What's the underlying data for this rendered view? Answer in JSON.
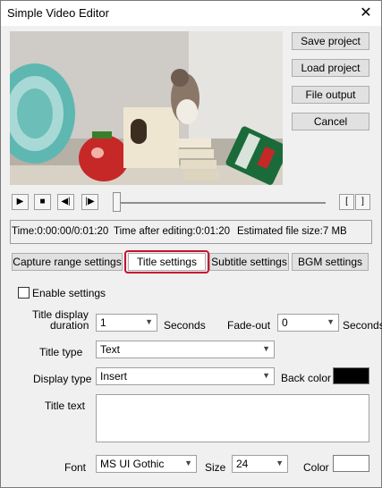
{
  "window": {
    "title": "Simple Video Editor"
  },
  "sidebar_buttons": {
    "save_project": "Save project",
    "load_project": "Load project",
    "file_output": "File output",
    "cancel": "Cancel"
  },
  "player": {
    "controls": [
      "▶",
      "■",
      "◀|",
      "|▶"
    ],
    "mark_in": "[",
    "mark_out": "]",
    "position_fraction": 0.0
  },
  "status": {
    "time": "Time:0:00:00/0:01:20",
    "after_edit": "Time after editing:0:01:20",
    "file_size": "Estimated file size:7 MB"
  },
  "tabs": [
    {
      "label": "Capture range settings",
      "active": false
    },
    {
      "label": "Title settings",
      "active": true
    },
    {
      "label": "Subtitle settings",
      "active": false
    },
    {
      "label": "BGM settings",
      "active": false
    }
  ],
  "title_settings": {
    "enable_label": "Enable settings",
    "enabled": false,
    "duration_label_line1": "Title display",
    "duration_label_line2": "duration",
    "duration_value": "1",
    "duration_unit": "Seconds",
    "fadeout_label": "Fade-out",
    "fadeout_value": "0",
    "fadeout_unit": "Seconds",
    "title_type_label": "Title type",
    "title_type_value": "Text",
    "display_type_label": "Display type",
    "display_type_value": "Insert",
    "back_color_label": "Back color",
    "back_color": "#000000",
    "title_text_label": "Title text",
    "title_text_value": "",
    "font_label": "Font",
    "font_value": "MS UI Gothic",
    "size_label": "Size",
    "size_value": "24",
    "color_label": "Color",
    "color": "#ffffff"
  },
  "icons": {
    "close": "close-icon",
    "dropdown": "chevron-down-icon"
  },
  "colors": {
    "highlight": "#c8102e",
    "window_bg": "#f0f0f0"
  }
}
